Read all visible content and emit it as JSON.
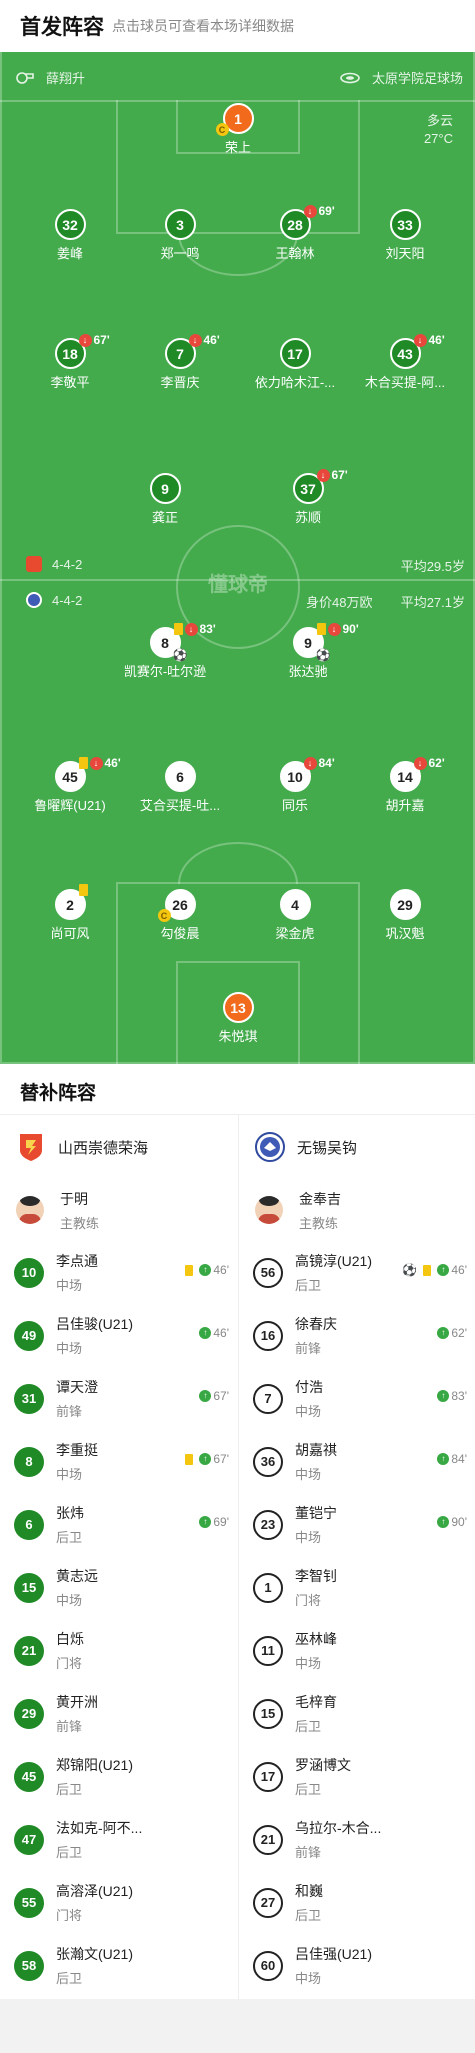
{
  "header": {
    "title": "首发阵容",
    "subtitle": "点击球员可查看本场详细数据"
  },
  "pitch": {
    "referee": "薛翔升",
    "stadium": "太原学院足球场",
    "weather": "多云",
    "temperature": "27°C",
    "watermark": "懂球帝",
    "home_info": {
      "formation": "4-4-2",
      "avg_age": "平均29.5岁"
    },
    "away_info": {
      "formation": "4-4-2",
      "value": "身价48万欧",
      "avg_age": "平均27.1岁"
    }
  },
  "home_lineup": [
    {
      "num": "1",
      "name": "荣上",
      "gk": true,
      "captain": true
    },
    {
      "num": "32",
      "name": "姜峰"
    },
    {
      "num": "3",
      "name": "郑一鸣"
    },
    {
      "num": "28",
      "name": "王翰林",
      "sub_min": "69'"
    },
    {
      "num": "33",
      "name": "刘天阳"
    },
    {
      "num": "18",
      "name": "李敬平",
      "sub_min": "67'"
    },
    {
      "num": "7",
      "name": "李晋庆",
      "sub_min": "46'"
    },
    {
      "num": "17",
      "name": "依力哈木江-..."
    },
    {
      "num": "43",
      "name": "木合买提-阿...",
      "sub_min": "46'"
    },
    {
      "num": "9",
      "name": "龚正"
    },
    {
      "num": "37",
      "name": "苏顺",
      "sub_min": "67'"
    }
  ],
  "away_lineup": [
    {
      "num": "8",
      "name": "凯赛尔-吐尔逊",
      "yellow": true,
      "sub_min": "83'",
      "goal": true
    },
    {
      "num": "9",
      "name": "张达驰",
      "yellow": true,
      "sub_min": "90'",
      "goal": true
    },
    {
      "num": "45",
      "name": "鲁曜辉(U21)",
      "yellow": true,
      "sub_min": "46'"
    },
    {
      "num": "6",
      "name": "艾合买提-吐..."
    },
    {
      "num": "10",
      "name": "同乐",
      "sub_min": "84'"
    },
    {
      "num": "14",
      "name": "胡升嘉",
      "sub_min": "62'"
    },
    {
      "num": "2",
      "name": "尚可风",
      "yellow": true
    },
    {
      "num": "26",
      "name": "勾俊晨",
      "captain": true
    },
    {
      "num": "4",
      "name": "梁金虎"
    },
    {
      "num": "29",
      "name": "巩汉魁"
    },
    {
      "num": "13",
      "name": "朱悦琪",
      "gk": true
    }
  ],
  "bench": {
    "title": "替补阵容",
    "home": {
      "team": "山西崇德荣海",
      "coach": {
        "name": "于明",
        "role": "主教练"
      },
      "players": [
        {
          "num": "10",
          "name": "李点通",
          "pos": "中场",
          "yellow": true,
          "in": "46'"
        },
        {
          "num": "49",
          "name": "吕佳骏(U21)",
          "pos": "中场",
          "in": "46'"
        },
        {
          "num": "31",
          "name": "谭天澄",
          "pos": "前锋",
          "in": "67'"
        },
        {
          "num": "8",
          "name": "李重挺",
          "pos": "中场",
          "yellow": true,
          "in": "67'"
        },
        {
          "num": "6",
          "name": "张炜",
          "pos": "后卫",
          "in": "69'"
        },
        {
          "num": "15",
          "name": "黄志远",
          "pos": "中场"
        },
        {
          "num": "21",
          "name": "白烁",
          "pos": "门将"
        },
        {
          "num": "29",
          "name": "黄开洲",
          "pos": "前锋"
        },
        {
          "num": "45",
          "name": "郑锦阳(U21)",
          "pos": "后卫"
        },
        {
          "num": "47",
          "name": "法如克-阿不...",
          "pos": "后卫"
        },
        {
          "num": "55",
          "name": "高溶泽(U21)",
          "pos": "门将"
        },
        {
          "num": "58",
          "name": "张瀚文(U21)",
          "pos": "后卫"
        }
      ]
    },
    "away": {
      "team": "无锡吴钩",
      "coach": {
        "name": "金奉吉",
        "role": "主教练"
      },
      "players": [
        {
          "num": "56",
          "name": "高镜淳(U21)",
          "pos": "后卫",
          "goal": true,
          "yellow": true,
          "in": "46'"
        },
        {
          "num": "16",
          "name": "徐春庆",
          "pos": "前锋",
          "in": "62'"
        },
        {
          "num": "7",
          "name": "付浩",
          "pos": "中场",
          "in": "83'"
        },
        {
          "num": "36",
          "name": "胡嘉祺",
          "pos": "中场",
          "in": "84'"
        },
        {
          "num": "23",
          "name": "董铠宁",
          "pos": "中场",
          "in": "90'"
        },
        {
          "num": "1",
          "name": "李智钊",
          "pos": "门将"
        },
        {
          "num": "11",
          "name": "巫林峰",
          "pos": "中场"
        },
        {
          "num": "15",
          "name": "毛梓育",
          "pos": "后卫"
        },
        {
          "num": "17",
          "name": "罗涵博文",
          "pos": "后卫"
        },
        {
          "num": "21",
          "name": "乌拉尔-木合...",
          "pos": "前锋"
        },
        {
          "num": "27",
          "name": "和巍",
          "pos": "后卫"
        },
        {
          "num": "60",
          "name": "吕佳强(U21)",
          "pos": "中场"
        }
      ]
    }
  },
  "colors": {
    "pitch": "#43ab4c",
    "home": "#1f8a26",
    "gk": "#f26a1b",
    "sub_out": "#e8473c",
    "sub_in": "#37a843",
    "yellow": "#f5c60f"
  }
}
